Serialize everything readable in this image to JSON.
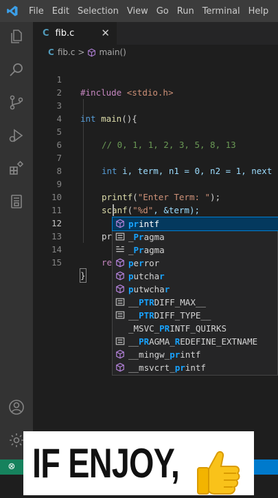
{
  "menubar": {
    "items": [
      "File",
      "Edit",
      "Selection",
      "View",
      "Go",
      "Run",
      "Terminal",
      "Help"
    ]
  },
  "activity_bar": {
    "icons": [
      "explorer-icon",
      "search-icon",
      "source-control-icon",
      "run-debug-icon",
      "extensions-icon",
      "remote-explorer-icon",
      "accounts-icon",
      "manage-gear-icon"
    ]
  },
  "tab": {
    "filename": "fib.c",
    "lang_icon": "C",
    "close_glyph": "✕"
  },
  "breadcrumb": {
    "lang_icon": "C",
    "file": "fib.c",
    "separator": ">",
    "symbol": "main()"
  },
  "code": {
    "line_numbers": [
      "1",
      "2",
      "3",
      "4",
      "5",
      "6",
      "7",
      "8",
      "9",
      "10",
      "11",
      "12",
      "13",
      "14",
      "15"
    ],
    "l1_directive": "#include",
    "l1_header": " <stdio.h>",
    "l3_type": "int",
    "l3_fn": " main",
    "l3_rest": "(){",
    "l5_comment": "// 0, 1, 1, 2, 3, 5, 8, 13",
    "l7_type": "int",
    "l7_rest": " i, term, n1 = 0, n2 = 1, next",
    "l9_fn": "printf",
    "l9_open": "(",
    "l9_str": "\"Enter Term: \"",
    "l9_close": ");",
    "l10_fn": "scanf",
    "l10_open": "(",
    "l10_str": "\"%d\"",
    "l10_rest": ", &term);",
    "l12_typed": "pr",
    "l14_partial": "re",
    "l15_brace": "}"
  },
  "suggestions": [
    {
      "kind": "function",
      "match": "pr",
      "rest": "intf",
      "selected": true
    },
    {
      "kind": "snippet",
      "pre": "_",
      "match": "Pr",
      "rest": "agma"
    },
    {
      "kind": "keyword",
      "pre": "_",
      "match": "Pr",
      "rest": "agma"
    },
    {
      "kind": "function",
      "pre": "pe",
      "match": "r",
      "rest": "ror"
    },
    {
      "kind": "function",
      "pre": "",
      "match": "p",
      "mid": "utcha",
      "match2": "r",
      "rest": ""
    },
    {
      "kind": "function",
      "pre": "",
      "match": "p",
      "mid": "utwcha",
      "match2": "r",
      "rest": ""
    },
    {
      "kind": "snippet",
      "pre": "__",
      "match": "PTR",
      "rest": "DIFF_MAX__"
    },
    {
      "kind": "snippet",
      "pre": "__",
      "match": "PTR",
      "rest": "DIFF_TYPE__"
    },
    {
      "kind": "snippet",
      "pre": "_MSVC_",
      "match": "PR",
      "rest": "INTF_QUIRKS"
    },
    {
      "kind": "snippet",
      "pre": "__",
      "match": "PR",
      "mid": "AGMA_",
      "match2": "R",
      "rest": "EDEFINE_EXTNAME"
    },
    {
      "kind": "function",
      "pre": "__mingw_",
      "match": "pr",
      "rest": "intf"
    },
    {
      "kind": "function",
      "pre": "__msvcrt_",
      "match": "pr",
      "rest": "intf"
    }
  ],
  "banner": {
    "text": "IF ENJOY,",
    "emoji_icon": "thumbs-up-icon"
  },
  "colors": {
    "keyword": "#569cd6",
    "function": "#dcdcaa",
    "string": "#ce9178",
    "comment": "#6a9955",
    "highlight": "#18a3ff",
    "statusbar": "#007acc",
    "remote": "#16825d"
  }
}
